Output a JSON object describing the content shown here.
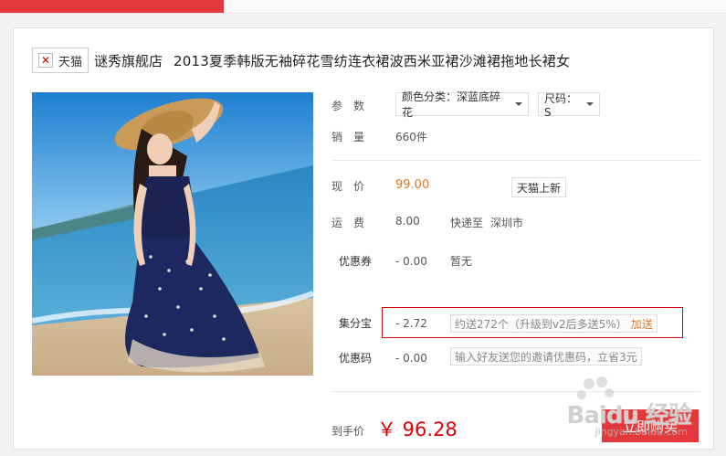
{
  "header": {
    "tmall_label": "天猫",
    "shop_name": "谜秀旗舰店",
    "product_title": "2013夏季韩版无袖碎花雪纺连衣裙波西米亚裙沙滩裙拖地长裙女"
  },
  "params": {
    "label": "参数",
    "color_select": "颜色分类：深蓝底碎花",
    "size_select": "尺码：S"
  },
  "sales": {
    "label": "销量",
    "value": "660件"
  },
  "current_price": {
    "label": "现价",
    "value": "99.00",
    "tag": "天猫上新"
  },
  "shipping": {
    "label": "运费",
    "value": "8.00",
    "dest_label": "快递至",
    "dest_value": "深圳市"
  },
  "coupon": {
    "label": "优惠券",
    "value": "- 0.00",
    "note": "暂无"
  },
  "points": {
    "label": "集分宝",
    "value": "- 2.72",
    "note": "约送272个（升级到v2后多送5%）",
    "link": "加送"
  },
  "promo_code": {
    "label": "优惠码",
    "value": "- 0.00",
    "hint": "输入好友送您的邀请优惠码，立省3元"
  },
  "final": {
    "label": "到手价",
    "value": "￥ 96.28"
  },
  "buy_button": "立即购买",
  "watermark": {
    "brand": "Baidu 经验",
    "url": "jingyan.baidu.com"
  },
  "colors": {
    "accent_red": "#e4393c",
    "price_orange": "#e07a1f",
    "final_red": "#d9000a"
  }
}
